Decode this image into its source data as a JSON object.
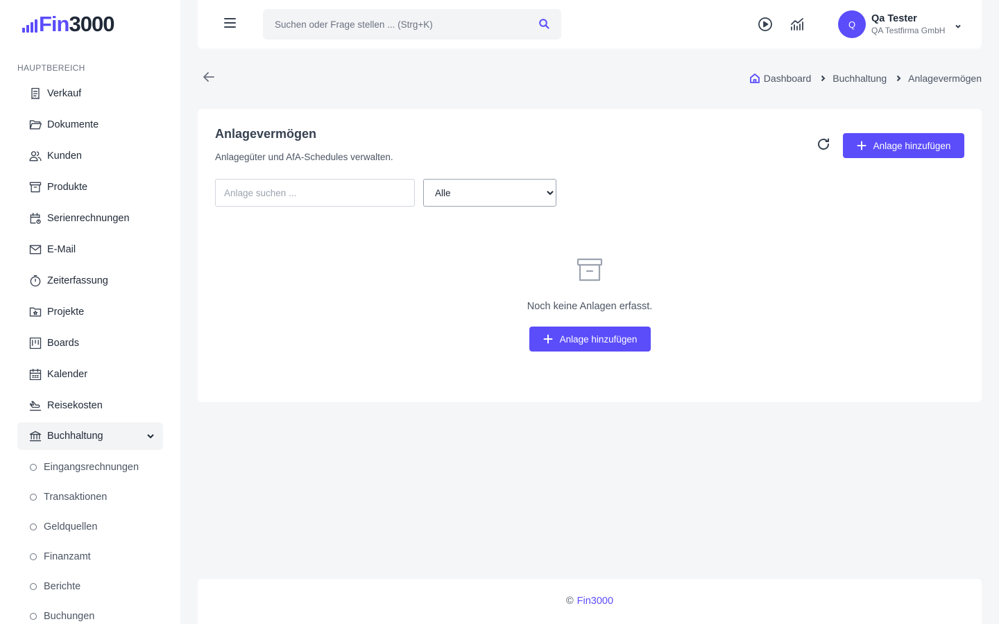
{
  "logo": {
    "prefix": "Fin",
    "rest": "3000"
  },
  "sidebar": {
    "section_label": "HAUPTBEREICH",
    "items": [
      {
        "label": "Verkauf",
        "icon": "receipt-icon"
      },
      {
        "label": "Dokumente",
        "icon": "folder-open-icon"
      },
      {
        "label": "Kunden",
        "icon": "users-icon"
      },
      {
        "label": "Produkte",
        "icon": "archive-icon"
      },
      {
        "label": "Serienrechnungen",
        "icon": "calendar-repeat-icon"
      },
      {
        "label": "E-Mail",
        "icon": "mail-icon"
      },
      {
        "label": "Zeiterfassung",
        "icon": "stopwatch-icon"
      },
      {
        "label": "Projekte",
        "icon": "folder-star-icon"
      },
      {
        "label": "Boards",
        "icon": "kanban-icon"
      },
      {
        "label": "Kalender",
        "icon": "calendar-icon"
      },
      {
        "label": "Reisekosten",
        "icon": "plane-icon"
      },
      {
        "label": "Buchhaltung",
        "icon": "bank-icon"
      }
    ],
    "subitems": [
      {
        "label": "Eingangsrechnungen"
      },
      {
        "label": "Transaktionen"
      },
      {
        "label": "Geldquellen"
      },
      {
        "label": "Finanzamt"
      },
      {
        "label": "Berichte"
      },
      {
        "label": "Buchungen"
      }
    ]
  },
  "header": {
    "search_placeholder": "Suchen oder Frage stellen ... (Strg+K)",
    "user": {
      "initial": "Q",
      "name": "Qa Tester",
      "company": "QA Testfirma GmbH"
    }
  },
  "breadcrumb": [
    "Dashboard",
    "Buchhaltung",
    "Anlagevermögen"
  ],
  "main": {
    "title": "Anlagevermögen",
    "subtitle": "Anlagegüter und AfA-Schedules verwalten.",
    "add_button_label": "Anlage hinzufügen",
    "search_placeholder": "Anlage suchen ...",
    "filter_selected": "Alle",
    "empty_text": "Noch keine Anlagen erfasst.",
    "empty_button_label": "Anlage hinzufügen"
  },
  "footer": {
    "copyright": "©",
    "brand": "Fin3000"
  },
  "colors": {
    "accent": "#5b4dfa",
    "background": "#f5f6f8",
    "card": "#ffffff"
  }
}
